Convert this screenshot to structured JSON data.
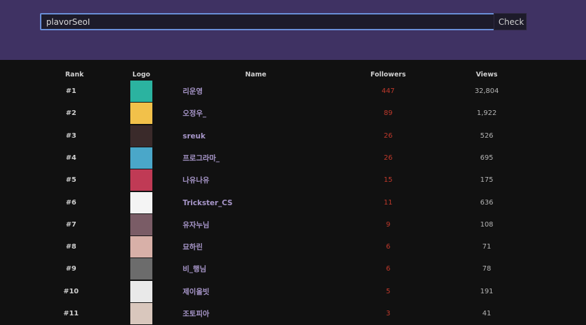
{
  "search": {
    "value": "plavorSeoI",
    "check_label": "Check"
  },
  "headers": {
    "rank": "Rank",
    "logo": "Logo",
    "name": "Name",
    "followers": "Followers",
    "views": "Views"
  },
  "rows": [
    {
      "rank": "#1",
      "name": "리운영",
      "followers": "447",
      "views": "32,804",
      "logo_color": "#2bb3a0"
    },
    {
      "rank": "#2",
      "name": "오정우_",
      "followers": "89",
      "views": "1,922",
      "logo_color": "#f2c14a"
    },
    {
      "rank": "#3",
      "name": "sreuk",
      "followers": "26",
      "views": "526",
      "logo_color": "#3a2a2a"
    },
    {
      "rank": "#4",
      "name": "프로그라마_",
      "followers": "26",
      "views": "695",
      "logo_color": "#4aa7c9"
    },
    {
      "rank": "#5",
      "name": "나유나유",
      "followers": "15",
      "views": "175",
      "logo_color": "#c03a55"
    },
    {
      "rank": "#6",
      "name": "Trickster_CS",
      "followers": "11",
      "views": "636",
      "logo_color": "#f4f4f4"
    },
    {
      "rank": "#7",
      "name": "유자누님",
      "followers": "9",
      "views": "108",
      "logo_color": "#7a5c66"
    },
    {
      "rank": "#8",
      "name": "묘하린",
      "followers": "6",
      "views": "71",
      "logo_color": "#d8b0a8"
    },
    {
      "rank": "#9",
      "name": "비_행님",
      "followers": "6",
      "views": "78",
      "logo_color": "#6c6c6c"
    },
    {
      "rank": "#10",
      "name": "제이올빗",
      "followers": "5",
      "views": "191",
      "logo_color": "#e9e9e9"
    },
    {
      "rank": "#11",
      "name": "조토피아",
      "followers": "3",
      "views": "41",
      "logo_color": "#d9c7bd"
    }
  ]
}
